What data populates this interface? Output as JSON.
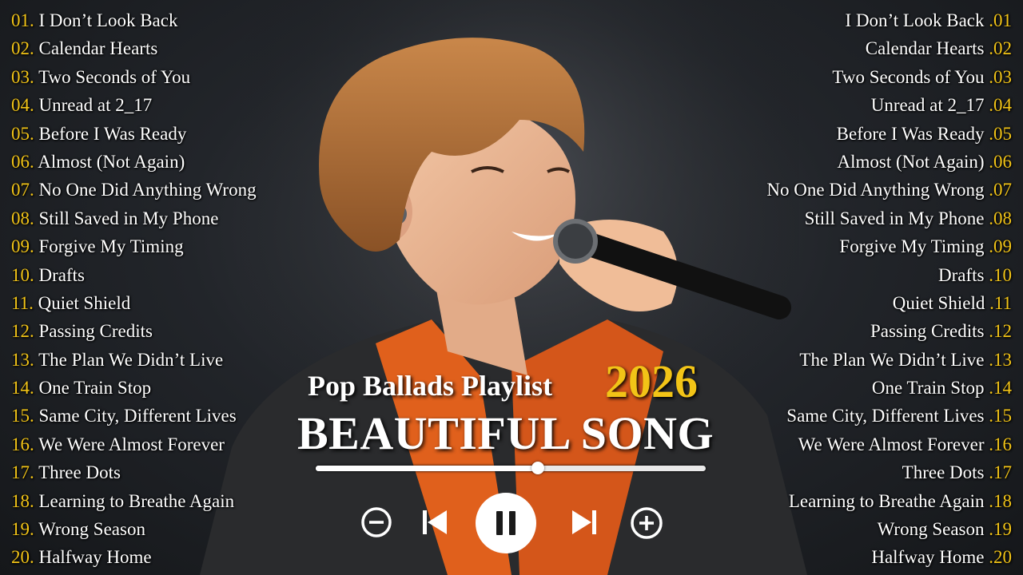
{
  "tracks": [
    {
      "num": "01.",
      "rnum": ".01",
      "title": "I Don’t Look Back"
    },
    {
      "num": "02.",
      "rnum": ".02",
      "title": "Calendar Hearts"
    },
    {
      "num": "03.",
      "rnum": ".03",
      "title": "Two Seconds of You"
    },
    {
      "num": "04.",
      "rnum": ".04",
      "title": "Unread at 2_17"
    },
    {
      "num": "05.",
      "rnum": ".05",
      "title": "Before I Was Ready"
    },
    {
      "num": "06.",
      "rnum": ".06",
      "title": "Almost (Not Again)"
    },
    {
      "num": "07.",
      "rnum": ".07",
      "title": "No One Did Anything Wrong"
    },
    {
      "num": "08.",
      "rnum": ".08",
      "title": "Still Saved in My Phone"
    },
    {
      "num": "09.",
      "rnum": ".09",
      "title": "Forgive My Timing"
    },
    {
      "num": "10.",
      "rnum": ".10",
      "title": "Drafts"
    },
    {
      "num": "11.",
      "rnum": ".11",
      "title": "Quiet Shield"
    },
    {
      "num": "12.",
      "rnum": ".12",
      "title": "Passing Credits"
    },
    {
      "num": "13.",
      "rnum": ".13",
      "title": "The Plan We Didn’t Live"
    },
    {
      "num": "14.",
      "rnum": ".14",
      "title": "One Train Stop"
    },
    {
      "num": "15.",
      "rnum": ".15",
      "title": "Same City, Different Lives"
    },
    {
      "num": "16.",
      "rnum": ".16",
      "title": "We Were Almost Forever"
    },
    {
      "num": "17.",
      "rnum": ".17",
      "title": "Three Dots"
    },
    {
      "num": "18.",
      "rnum": ".18",
      "title": "Learning to Breathe Again"
    },
    {
      "num": "19.",
      "rnum": ".19",
      "title": "Wrong Season"
    },
    {
      "num": "20.",
      "rnum": ".20",
      "title": "Halfway Home"
    }
  ],
  "header": {
    "playlist_label": "Pop Ballads Playlist",
    "year": "2026",
    "main_title": "BEAUTIFUL SONG"
  },
  "player": {
    "progress": 0.57,
    "controls": [
      "minus-circle-icon",
      "skip-previous-icon",
      "pause-icon",
      "skip-next-icon",
      "plus-circle-icon"
    ]
  },
  "colors": {
    "accent": "#f2c417",
    "text": "#ffffff",
    "shirt": "#e0601c",
    "jacket": "#2a2b2d"
  }
}
